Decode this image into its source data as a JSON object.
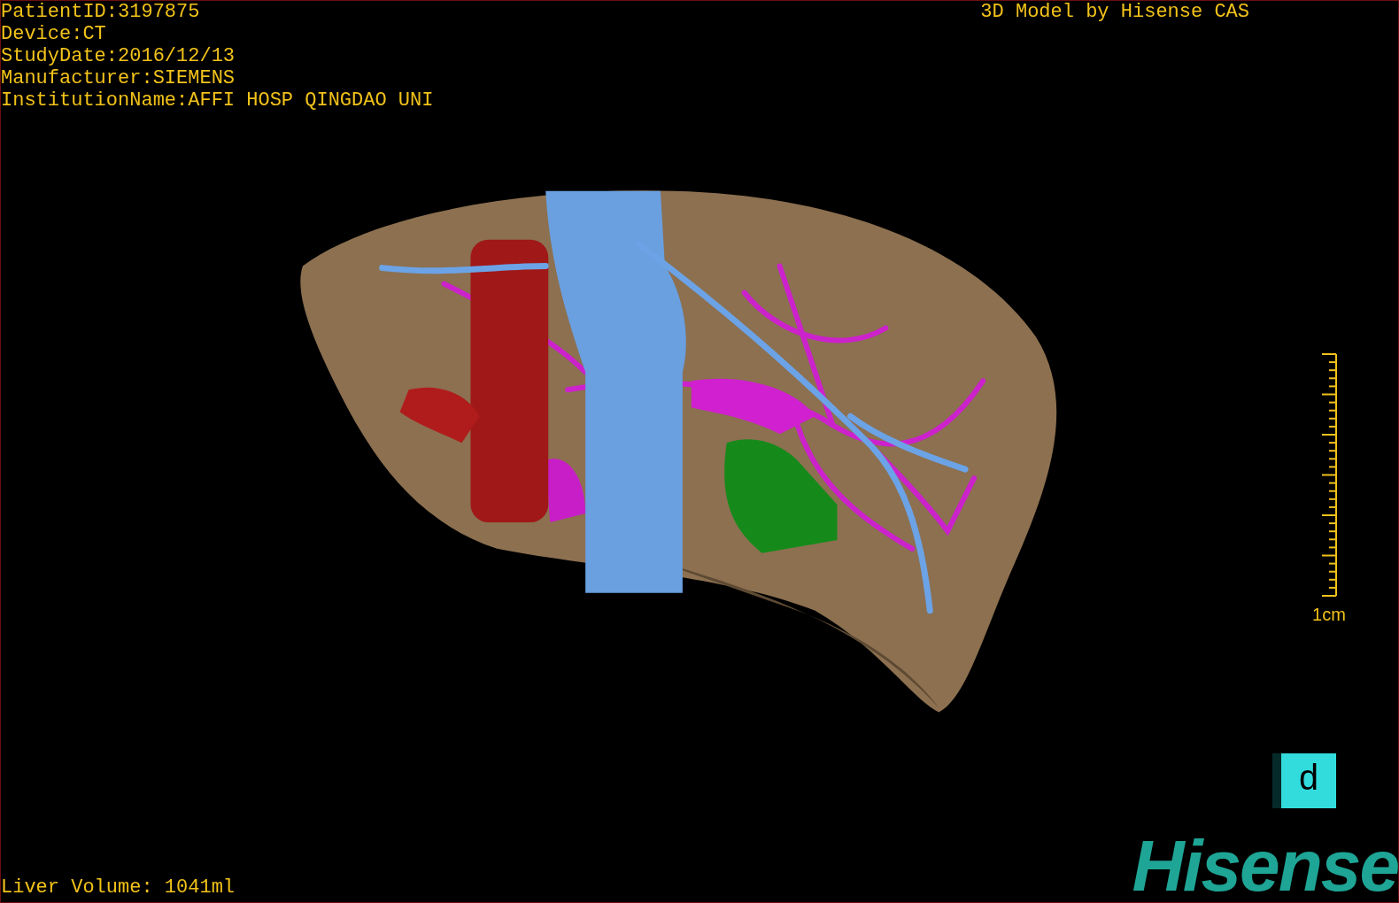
{
  "header": {
    "info": [
      "PatientID:3197875",
      "Device:CT",
      "StudyDate:2016/12/13",
      "Manufacturer:SIEMENS",
      "InstitutionName:AFFI HOSP QINGDAO UNI"
    ],
    "title": "3D Model by Hisense CAS"
  },
  "scale": {
    "label": "1cm"
  },
  "orientation_cube": {
    "face": "d"
  },
  "footer": {
    "volume": "Liver Volume: 1041ml",
    "logo": "Hisense"
  }
}
